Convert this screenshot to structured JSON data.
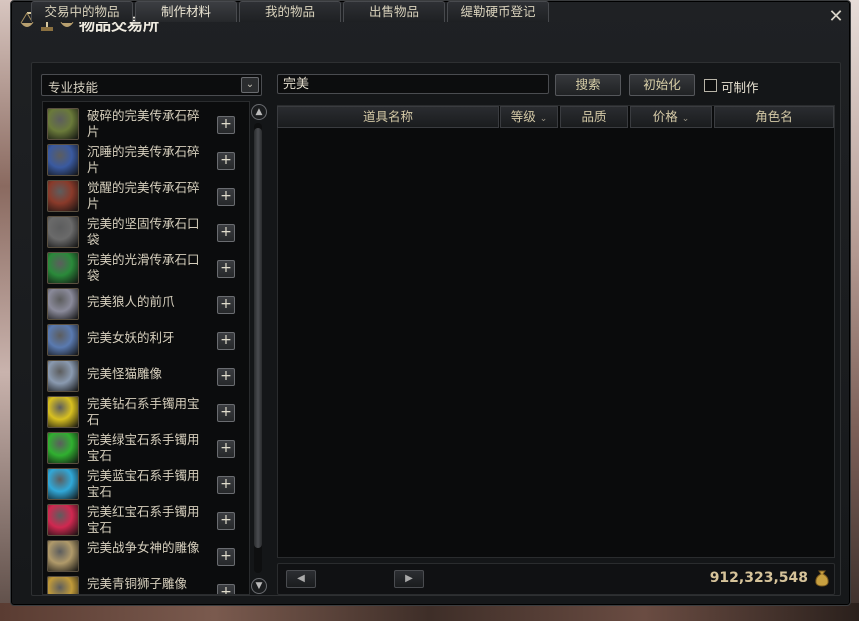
{
  "window": {
    "title": "物品交易所",
    "close_label": "✕"
  },
  "tabs": [
    {
      "label": "交易中的物品"
    },
    {
      "label": "制作材料"
    },
    {
      "label": "我的物品"
    },
    {
      "label": "出售物品"
    },
    {
      "label": "缇勒硬币登记"
    }
  ],
  "filter": {
    "category": "专业技能",
    "arrow": "⌄"
  },
  "search": {
    "value": "完美",
    "search_label": "搜索",
    "reset_label": "初始化",
    "craftable_label": "可制作",
    "craftable_checked": false
  },
  "items": [
    {
      "name": "破碎的完美传承石碎片",
      "icon": "scroll-book-icon",
      "color": "#6a7a3a"
    },
    {
      "name": "沉睡的完美传承石碎片",
      "icon": "blue-book-icon",
      "color": "#3a5aa0"
    },
    {
      "name": "觉醒的完美传承石碎片",
      "icon": "red-book-icon",
      "color": "#8a3a2a"
    },
    {
      "name": "完美的坚固传承石口袋",
      "icon": "pouch-icon",
      "color": "#6a6a6a"
    },
    {
      "name": "完美的光滑传承石口袋",
      "icon": "green-pouch-icon",
      "color": "#2a8a3a"
    },
    {
      "name": "完美狼人的前爪",
      "icon": "claw-icon",
      "color": "#8a8a9a"
    },
    {
      "name": "完美女妖的利牙",
      "icon": "fang-icon",
      "color": "#5a7ab0"
    },
    {
      "name": "完美怪猫雕像",
      "icon": "statue-icon",
      "color": "#8a9ab0"
    },
    {
      "name": "完美钻石系手镯用宝石",
      "icon": "yellow-gem-icon",
      "color": "#d8c020"
    },
    {
      "name": "完美绿宝石系手镯用宝石",
      "icon": "green-gem-icon",
      "color": "#30b030"
    },
    {
      "name": "完美蓝宝石系手镯用宝石",
      "icon": "blue-gem-icon",
      "color": "#30a8d8"
    },
    {
      "name": "完美红宝石系手镯用宝石",
      "icon": "red-gem-icon",
      "color": "#d02850"
    },
    {
      "name": "完美战争女神的雕像",
      "icon": "goddess-statue-icon",
      "color": "#b09a6a"
    },
    {
      "name": "完美青铜狮子雕像",
      "icon": "lion-statue-icon",
      "color": "#c09a3a"
    }
  ],
  "table": {
    "headers": [
      "道具名称",
      "等级",
      "品质",
      "价格",
      "角色名"
    ],
    "rows": []
  },
  "footer": {
    "prev": "◀",
    "next": "▶",
    "gold": "912,323,548"
  }
}
